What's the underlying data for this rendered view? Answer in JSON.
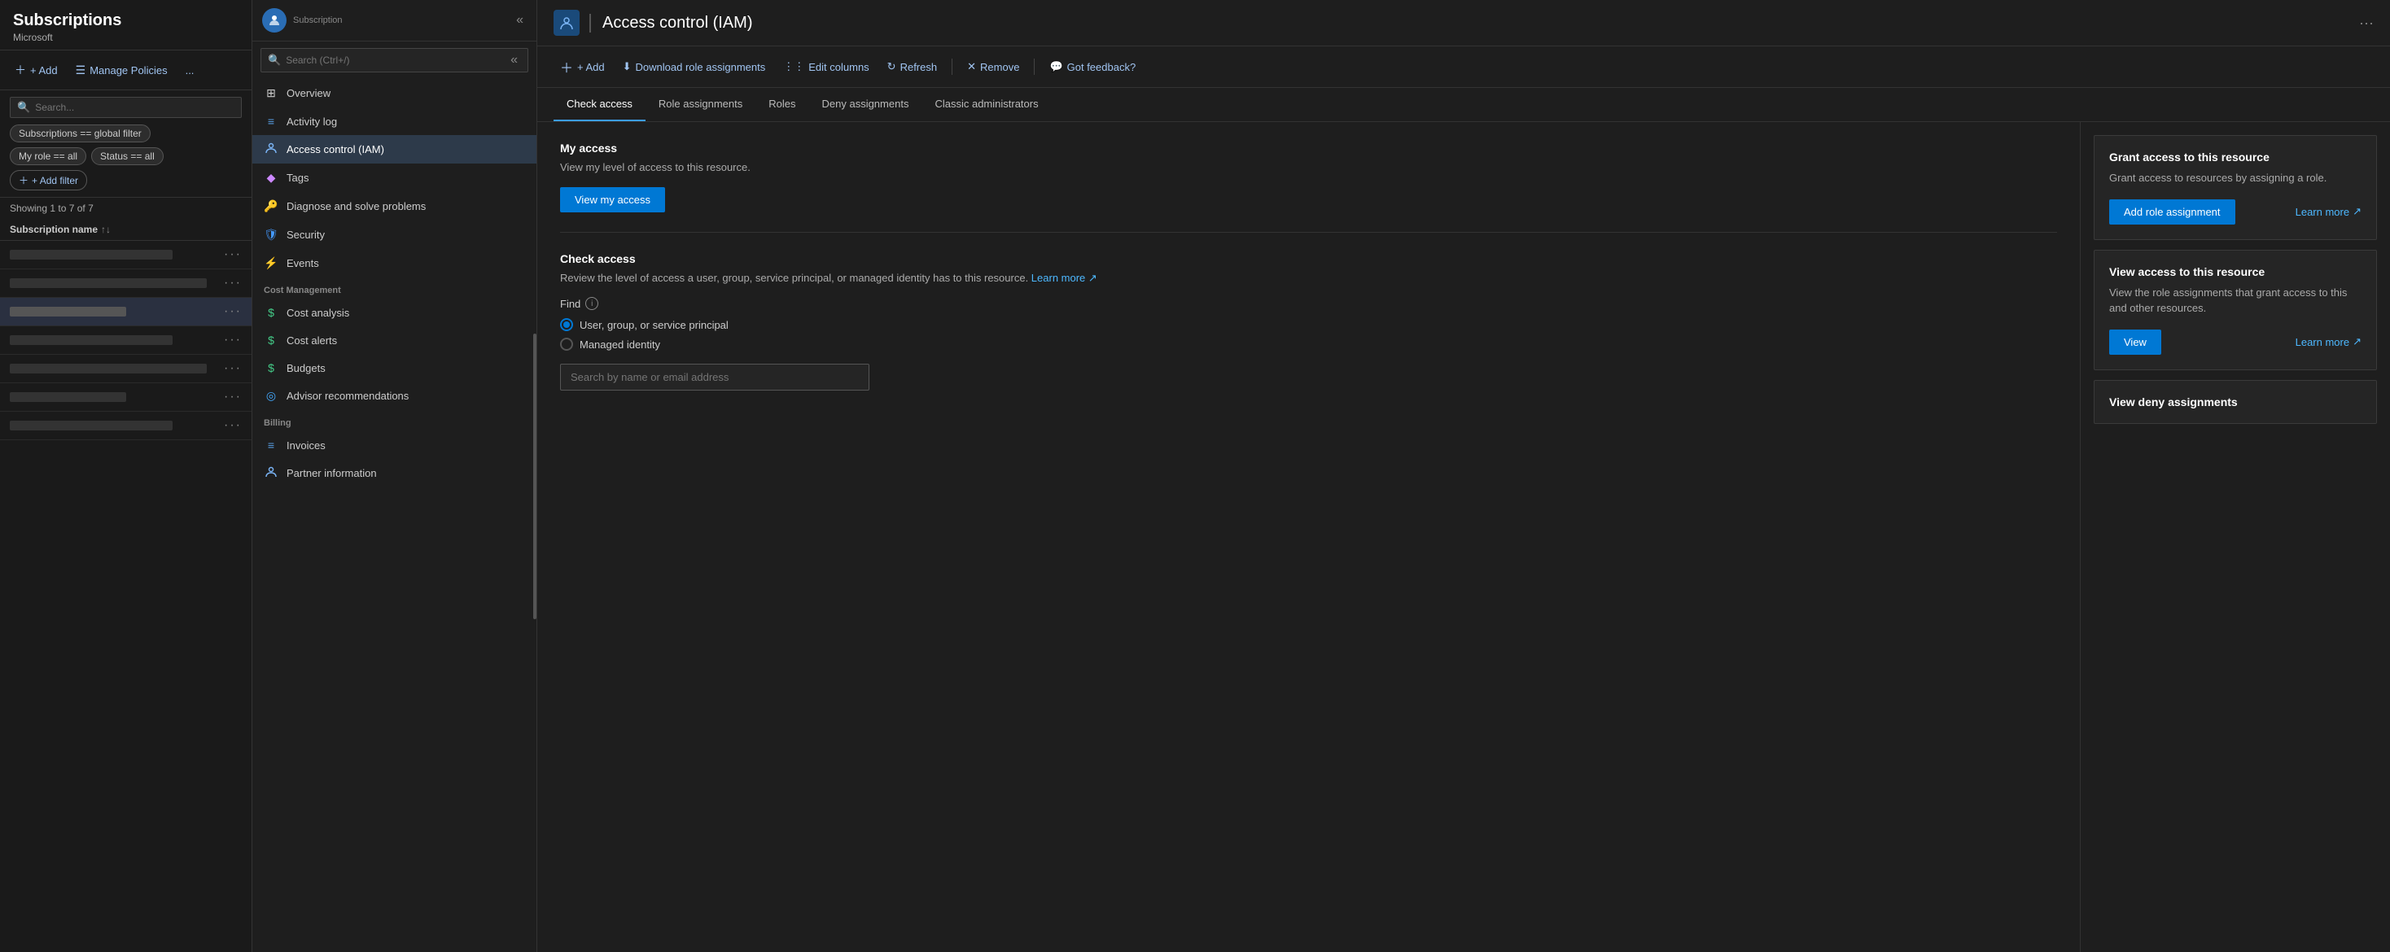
{
  "leftPanel": {
    "title": "Subscriptions",
    "subtitle": "Microsoft",
    "toolbar": {
      "add": "+ Add",
      "managePolicies": "Manage Policies",
      "more": "..."
    },
    "globalFilter": "Subscriptions == global filter",
    "filters": {
      "myRole": "My role == all",
      "status": "Status == all",
      "addFilter": "+ Add filter"
    },
    "showing": "Showing 1 to 7 of 7",
    "columnHeader": "Subscription name",
    "rows": [
      {
        "hasName": false
      },
      {
        "hasName": false
      },
      {
        "hasName": false,
        "highlighted": true
      },
      {
        "hasName": false
      },
      {
        "hasName": false
      },
      {
        "hasName": false
      },
      {
        "hasName": false
      }
    ]
  },
  "middlePanel": {
    "subscriptionLabel": "Subscription",
    "searchPlaceholder": "Search (Ctrl+/)",
    "navItems": [
      {
        "label": "Overview",
        "icon": "⊞",
        "section": null
      },
      {
        "label": "Activity log",
        "icon": "≡",
        "section": null
      },
      {
        "label": "Access control (IAM)",
        "icon": "👤",
        "section": null,
        "active": true
      },
      {
        "label": "Tags",
        "icon": "◆",
        "section": null
      },
      {
        "label": "Diagnose and solve problems",
        "icon": "🔑",
        "section": null
      },
      {
        "label": "Security",
        "icon": "🛡",
        "section": null
      },
      {
        "label": "Events",
        "icon": "⚡",
        "section": null
      }
    ],
    "sections": [
      {
        "header": "Cost Management",
        "items": [
          {
            "label": "Cost analysis",
            "icon": "$"
          },
          {
            "label": "Cost alerts",
            "icon": "$"
          },
          {
            "label": "Budgets",
            "icon": "$"
          },
          {
            "label": "Advisor recommendations",
            "icon": "◎"
          }
        ]
      },
      {
        "header": "Billing",
        "items": [
          {
            "label": "Invoices",
            "icon": "≡"
          },
          {
            "label": "Partner information",
            "icon": "👤"
          }
        ]
      }
    ]
  },
  "rightPanel": {
    "title": "Access control (IAM)",
    "moreIcon": "···",
    "toolbar": {
      "add": "+ Add",
      "download": "Download role assignments",
      "editColumns": "Edit columns",
      "refresh": "Refresh",
      "remove": "Remove",
      "feedback": "Got feedback?"
    },
    "tabs": [
      {
        "label": "Check access",
        "active": true
      },
      {
        "label": "Role assignments"
      },
      {
        "label": "Roles"
      },
      {
        "label": "Deny assignments"
      },
      {
        "label": "Classic administrators"
      }
    ],
    "checkAccess": {
      "myAccess": {
        "title": "My access",
        "desc": "View my level of access to this resource.",
        "button": "View my access"
      },
      "checkAccess": {
        "title": "Check access",
        "desc": "Review the level of access a user, group, service principal, or managed identity has to this resource.",
        "learnMore": "Learn more",
        "findLabel": "Find",
        "radioOptions": [
          {
            "label": "User, group, or service principal",
            "selected": true
          },
          {
            "label": "Managed identity",
            "selected": false
          }
        ],
        "searchPlaceholder": "Search by name or email address"
      }
    },
    "cards": [
      {
        "title": "Grant access to this resource",
        "desc": "Grant access to resources by assigning a role.",
        "button": "Add role assignment",
        "learnMore": "Learn more"
      },
      {
        "title": "View access to this resource",
        "desc": "View the role assignments that grant access to this and other resources.",
        "button": "View",
        "learnMore": "Learn more"
      },
      {
        "title": "View deny assignments",
        "partial": true
      }
    ]
  }
}
